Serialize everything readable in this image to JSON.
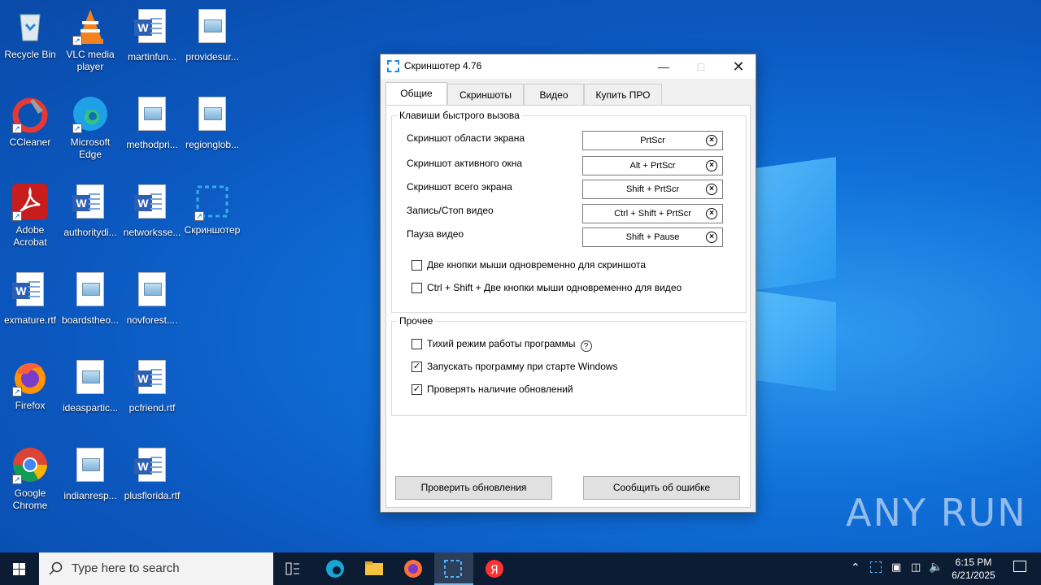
{
  "desktop": {
    "icons": [
      {
        "label": "Recycle Bin"
      },
      {
        "label": "VLC media player"
      },
      {
        "label": "martinfun..."
      },
      {
        "label": "providesur..."
      },
      {
        "label": "CCleaner"
      },
      {
        "label": "Microsoft Edge"
      },
      {
        "label": "methodpri..."
      },
      {
        "label": "regionglob..."
      },
      {
        "label": "Adobe Acrobat"
      },
      {
        "label": "authoritydi..."
      },
      {
        "label": "networksse..."
      },
      {
        "label": "Скриншотер"
      },
      {
        "label": "exmature.rtf"
      },
      {
        "label": "boardstheo..."
      },
      {
        "label": "novforest...."
      },
      {
        "label": "Firefox"
      },
      {
        "label": "ideaspartic..."
      },
      {
        "label": "pcfriend.rtf"
      },
      {
        "label": "Google Chrome"
      },
      {
        "label": "indianresp..."
      },
      {
        "label": "plusflorida.rtf"
      }
    ],
    "watermark": "ANY RUN"
  },
  "window": {
    "title": "Скриншотер 4.76",
    "tabs": [
      {
        "label": "Общие"
      },
      {
        "label": "Скриншоты"
      },
      {
        "label": "Видео"
      },
      {
        "label": "Купить ПРО"
      }
    ],
    "hotkeys_group": "Клавиши быстрого вызова",
    "hotkeys": [
      {
        "label": "Скриншот области экрана",
        "key": "PrtScr"
      },
      {
        "label": "Скриншот активного окна",
        "key": "Alt + PrtScr"
      },
      {
        "label": "Скриншот всего экрана",
        "key": "Shift + PrtScr"
      },
      {
        "label": "Запись/Стоп видео",
        "key": "Ctrl + Shift + PrtScr"
      },
      {
        "label": "Пауза видео",
        "key": "Shift + Pause"
      }
    ],
    "mouse_options": [
      {
        "label": "Две кнопки мыши одновременно для скриншота",
        "checked": false
      },
      {
        "label": "Ctrl + Shift + Две кнопки мыши одновременно для видео",
        "checked": false
      }
    ],
    "other_group": "Прочее",
    "other_options": [
      {
        "label": "Тихий режим работы программы",
        "checked": false
      },
      {
        "label": "Запускать программу при старте Windows",
        "checked": true
      },
      {
        "label": "Проверять наличие обновлений",
        "checked": true
      }
    ],
    "check_updates_button": "Проверить обновления",
    "report_bug_button": "Сообщить об ошибке"
  },
  "taskbar": {
    "search_placeholder": "Type here to search",
    "time": "6:15 PM",
    "date": "6/21/2025"
  },
  "colors": {
    "desktop_blue": "#0b58c0",
    "taskbar": "#0c1c33",
    "accent": "#1e88e5"
  }
}
